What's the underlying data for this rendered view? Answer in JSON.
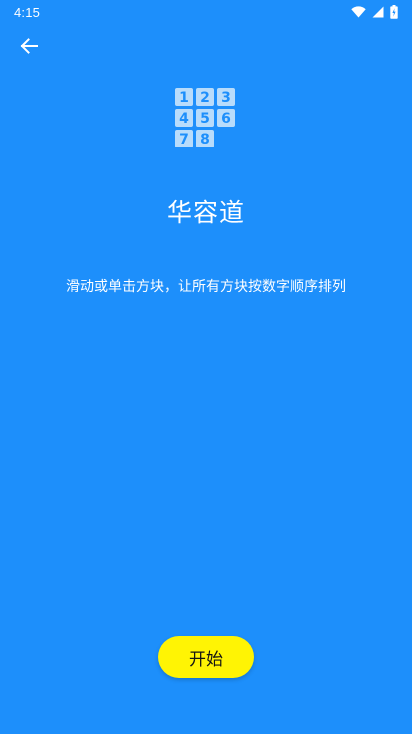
{
  "status_bar": {
    "time": "4:15",
    "icons": [
      "wifi-icon",
      "signal-icon",
      "battery-icon"
    ]
  },
  "header": {
    "back_icon": "arrow-left-icon"
  },
  "logo": {
    "tiles": [
      "1",
      "2",
      "3",
      "4",
      "5",
      "6",
      "7",
      "8"
    ],
    "tile_color": "#b8dcfb",
    "tile_text_color": "#1d8ffb"
  },
  "main": {
    "title": "华容道",
    "instructions": "滑动或单击方块，让所有方块按数字顺序排列"
  },
  "actions": {
    "start_label": "开始"
  },
  "colors": {
    "background": "#1d8ffb",
    "button": "#fff404",
    "text": "#ffffff"
  }
}
